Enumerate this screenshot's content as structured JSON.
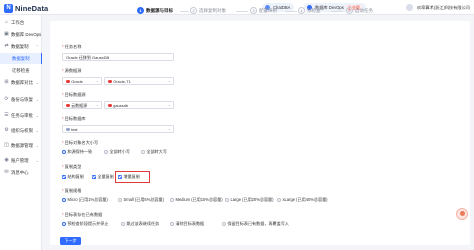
{
  "app": {
    "logo": "N",
    "name": "NineData"
  },
  "topbar": {
    "chatdba": "ChatDBA",
    "devops": "数据库 DevOps",
    "devops_tag": "企业版",
    "org": "玖章算术(浙江)科技有限公司"
  },
  "sidebar": {
    "items": [
      {
        "label": "工作台",
        "icon": "⌂"
      },
      {
        "label": "数据库 DevOps",
        "icon": "▣"
      },
      {
        "label": "数据复制",
        "icon": "⇄"
      },
      {
        "label": "数据复制",
        "icon": ""
      },
      {
        "label": "迁移检查",
        "icon": ""
      },
      {
        "label": "数据库对比",
        "icon": "⊞"
      },
      {
        "label": "备份与恢复",
        "icon": "⟳"
      },
      {
        "label": "任务与审批",
        "icon": "☰"
      },
      {
        "label": "组织与权限",
        "icon": "⚙"
      },
      {
        "label": "数据源管理",
        "icon": "◫"
      },
      {
        "label": "账户管理",
        "icon": "◉"
      },
      {
        "label": "消息中心",
        "icon": "✉"
      }
    ]
  },
  "steps": [
    {
      "num": "1",
      "label": "数据源与目标"
    },
    {
      "num": "2",
      "label": "选择复制对象"
    },
    {
      "num": "3",
      "label": "配置映射"
    },
    {
      "num": "4",
      "label": "预检查"
    },
    {
      "num": "5",
      "label": "启动任务"
    }
  ],
  "form": {
    "task_name_label": "任务名称",
    "task_name_value": "Oracle 迁移到 GaussDB",
    "source_label": "源数据源",
    "source_type": "Oracle",
    "source_value": "Oracle-T1",
    "target_label": "目标数据源",
    "target_type": "云数据源",
    "target_value": "gaussdb",
    "target_db_label": "目标数据库",
    "target_db_value": "test",
    "conflict_label": "目标对象名大小写",
    "conflict_options": [
      "和源保持一致",
      "全部转小写",
      "全部转大写"
    ],
    "copy_type_label": "复制类型",
    "copy_types": [
      "结构复制",
      "全量复制",
      "增量复制"
    ],
    "spec_label": "复制规格",
    "spec_options": [
      "Micro (已用1%总容量)",
      "Small (已用5%总容量)",
      "Medium (已用10%总容量)",
      "Large (已用20%总容量)",
      "xLarge (已用40%总容量)"
    ],
    "target_exists_label": "目标表存在已有数据",
    "target_exists_options": [
      "预检查阶段提示并停止",
      "跳过该表继续任务",
      "清除目标表数据",
      "保留目标表已有数据，再覆盖写入"
    ],
    "next_button": "下一步"
  }
}
